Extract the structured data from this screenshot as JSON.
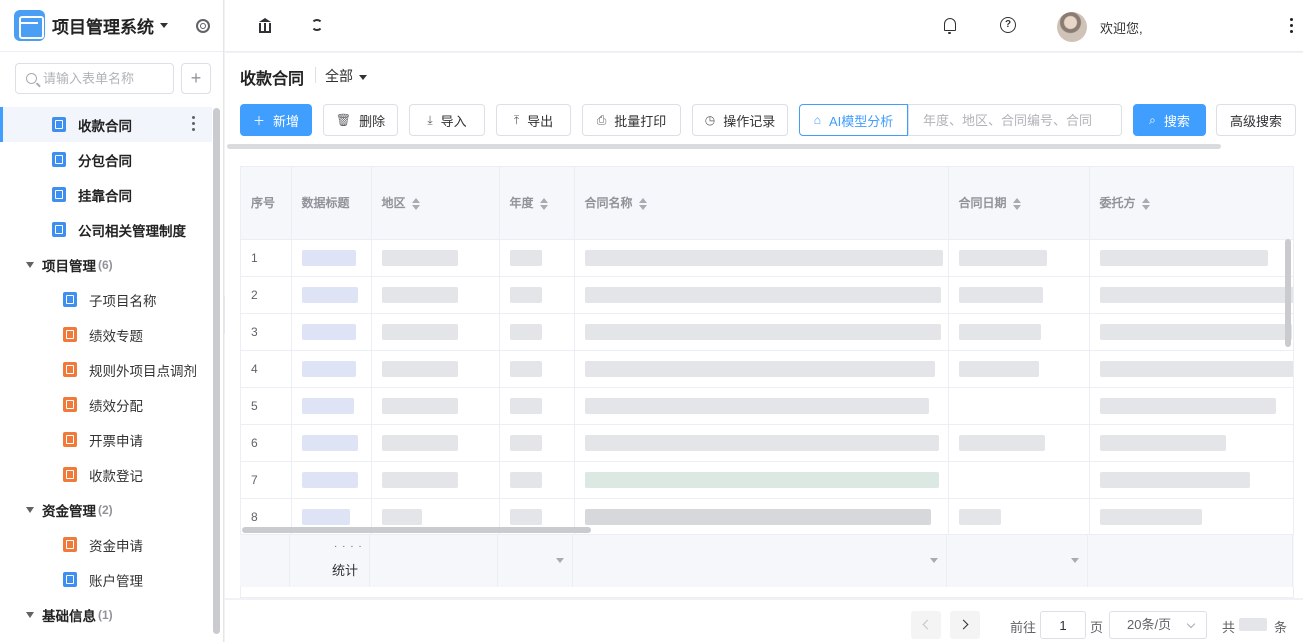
{
  "app": {
    "title": "项目管理系统"
  },
  "sidebar": {
    "search_placeholder": "请输入表单名称",
    "add_label": "+",
    "items": [
      {
        "label": "收款合同",
        "level": 1,
        "icon": "form-icon",
        "color": "#3d8ff0",
        "active": true
      },
      {
        "label": "分包合同",
        "level": 1,
        "icon": "form-icon",
        "color": "#3d8ff0"
      },
      {
        "label": "挂靠合同",
        "level": 1,
        "icon": "form-icon",
        "color": "#3d8ff0"
      },
      {
        "label": "公司相关管理制度",
        "level": 1,
        "icon": "form-icon",
        "color": "#3d8ff0"
      }
    ],
    "groups": [
      {
        "label": "项目管理",
        "count": "(6)",
        "children": [
          "子项目名称",
          "绩效专题",
          "规则外项目点调剂",
          "绩效分配",
          "开票申请",
          "收款登记"
        ]
      },
      {
        "label": "资金管理",
        "count": "(2)",
        "children": [
          "资金申请",
          "账户管理"
        ]
      },
      {
        "label": "基础信息",
        "count": "(1)",
        "children": []
      }
    ]
  },
  "topbar": {
    "welcome": "欢迎您,"
  },
  "page": {
    "title": "收款合同",
    "filter": "全部"
  },
  "toolbar": {
    "add": "新增",
    "delete": "删除",
    "import": "导入",
    "export": "导出",
    "batch_print": "批量打印",
    "op_log": "操作记录",
    "ai_analysis": "AI模型分析",
    "search_placeholder": "年度、地区、合同编号、合同",
    "search": "搜索",
    "advanced": "高级搜索"
  },
  "table": {
    "columns": [
      "序号",
      "数据标题",
      "地区",
      "年度",
      "合同名称",
      "合同日期",
      "委托方"
    ],
    "rows": [
      "1",
      "2",
      "3",
      "4",
      "5",
      "6",
      "7",
      "8"
    ],
    "summary_label": "统计",
    "summary_dots": "· · · ·"
  },
  "pager": {
    "goto": "前往",
    "page": "1",
    "page_unit": "页",
    "page_size": "20条/页",
    "total_prefix": "共",
    "total_suffix": "条"
  }
}
